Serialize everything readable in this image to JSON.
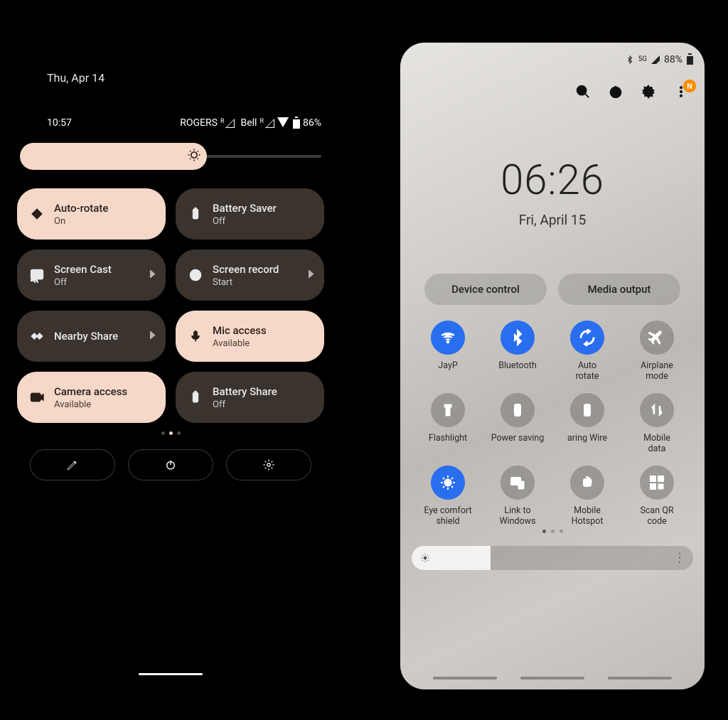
{
  "left": {
    "date": "Thu, Apr 14",
    "time": "10:57",
    "carrier1": "ROGERS",
    "carrier2": "Bell",
    "battery": "86%",
    "brightness_percent": 62,
    "tiles": [
      {
        "title": "Auto-rotate",
        "sub": "On",
        "state": "on",
        "icon": "rotate",
        "chevron": false
      },
      {
        "title": "Battery Saver",
        "sub": "Off",
        "state": "off",
        "icon": "battery-saver",
        "chevron": false
      },
      {
        "title": "Screen Cast",
        "sub": "Off",
        "state": "off",
        "icon": "cast",
        "chevron": true
      },
      {
        "title": "Screen record",
        "sub": "Start",
        "state": "off",
        "icon": "record",
        "chevron": true
      },
      {
        "title": "Nearby Share",
        "sub": "",
        "state": "off",
        "icon": "nearby",
        "chevron": true
      },
      {
        "title": "Mic access",
        "sub": "Available",
        "state": "on",
        "icon": "mic",
        "chevron": false
      },
      {
        "title": "Camera access",
        "sub": "Available",
        "state": "on",
        "icon": "camera",
        "chevron": false
      },
      {
        "title": "Battery Share",
        "sub": "Off",
        "state": "off",
        "icon": "battery-share",
        "chevron": false
      }
    ],
    "page_index": 1,
    "page_count": 3
  },
  "right": {
    "status": {
      "battery": "88%",
      "network_label": "5G"
    },
    "notification_badge": "N",
    "clock": {
      "time": "06:26",
      "date": "Fri, April 15"
    },
    "pills": [
      {
        "label": "Device control"
      },
      {
        "label": "Media output"
      }
    ],
    "tiles": [
      {
        "label": "JayP",
        "state": "on",
        "icon": "wifi"
      },
      {
        "label": "Bluetooth",
        "state": "on",
        "icon": "bluetooth"
      },
      {
        "label": "Auto\nrotate",
        "state": "on",
        "icon": "rotate"
      },
      {
        "label": "Airplane\nmode",
        "state": "off",
        "icon": "airplane"
      },
      {
        "label": "Flashlight",
        "state": "off",
        "icon": "flashlight"
      },
      {
        "label": "Power saving",
        "state": "off",
        "icon": "powersave"
      },
      {
        "label": "aring      Wire",
        "state": "off",
        "icon": "share"
      },
      {
        "label": "Mobile\ndata",
        "state": "off",
        "icon": "mobiledata"
      },
      {
        "label": "Eye comfort\nshield",
        "state": "on",
        "icon": "eyecomfort"
      },
      {
        "label": "Link to\nWindows",
        "state": "off",
        "icon": "link"
      },
      {
        "label": "Mobile\nHotspot",
        "state": "off",
        "icon": "hotspot"
      },
      {
        "label": "Scan QR\ncode",
        "state": "off",
        "icon": "qr"
      }
    ],
    "page_index": 0,
    "page_count": 3,
    "brightness_percent": 28
  }
}
